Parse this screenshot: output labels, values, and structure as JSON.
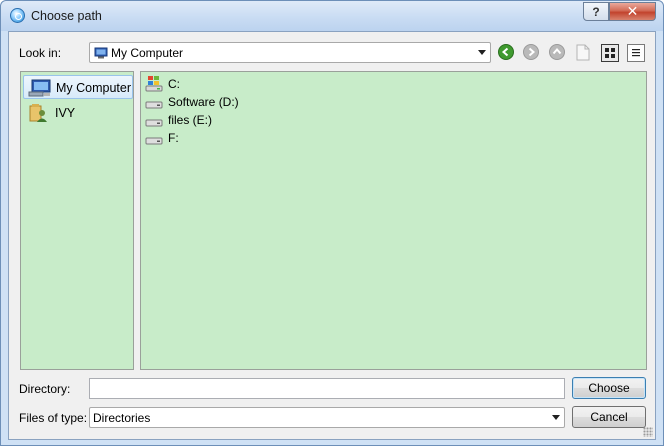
{
  "window": {
    "title": "Choose path"
  },
  "titlebar": {
    "help_label": "?",
    "close_label": "✕"
  },
  "toolbar": {
    "look_in_label": "Look in:",
    "look_in_value": "My Computer",
    "icons": [
      "back-icon",
      "forward-icon",
      "up-icon",
      "new-folder-icon",
      "icon-view-icon",
      "detail-view-icon"
    ]
  },
  "sidebar": {
    "items": [
      {
        "label": "My Computer",
        "icon": "computer-icon",
        "selected": true
      },
      {
        "label": "IVY",
        "icon": "user-folder-icon",
        "selected": false
      }
    ]
  },
  "files": {
    "items": [
      {
        "label": "C:",
        "icon": "system-drive-icon"
      },
      {
        "label": "Software (D:)",
        "icon": "hard-drive-icon"
      },
      {
        "label": "files (E:)",
        "icon": "hard-drive-icon"
      },
      {
        "label": "F:",
        "icon": "hard-drive-icon"
      }
    ]
  },
  "footer": {
    "directory_label": "Directory:",
    "directory_value": "",
    "files_of_type_label": "Files of type:",
    "files_of_type_value": "Directories",
    "choose_label": "Choose",
    "cancel_label": "Cancel"
  },
  "colors": {
    "pane_bg": "#c8ecc9",
    "titlebar": "#c9dcf3",
    "close": "#c2432d"
  }
}
